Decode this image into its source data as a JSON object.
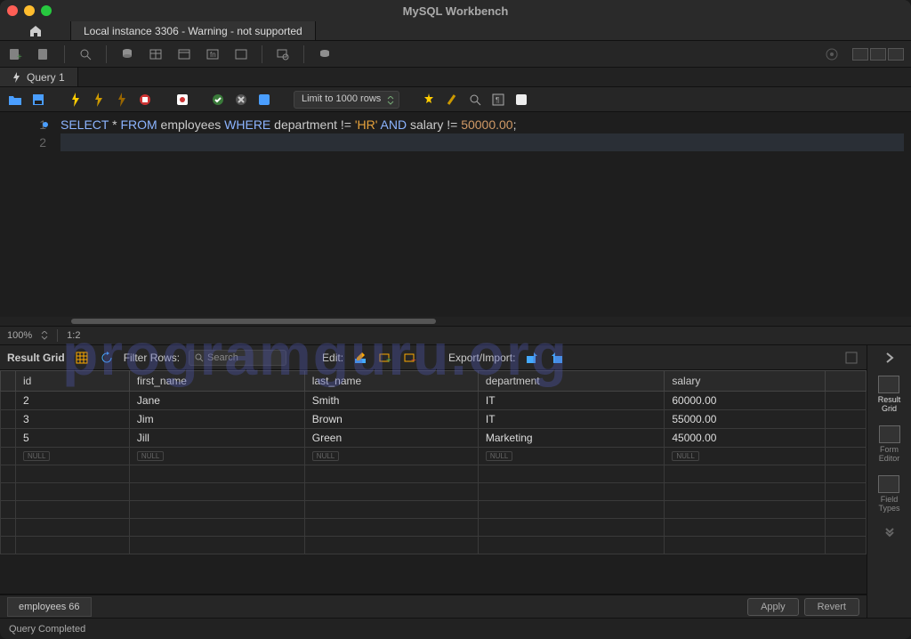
{
  "app_title": "MySQL Workbench",
  "connection_tab": "Local instance 3306 - Warning - not supported",
  "query_tab": "Query 1",
  "limit_label": "Limit to 1000 rows",
  "sql": {
    "line1_tokens": [
      "SELECT",
      " * ",
      "FROM",
      " employees ",
      "WHERE",
      " department != ",
      "'HR'",
      " ",
      "AND",
      " salary != ",
      "50000.00",
      ";"
    ]
  },
  "zoom": {
    "pct": "100%",
    "ratio": "1:2"
  },
  "result_toolbar": {
    "label": "Result Grid",
    "filter_label": "Filter Rows:",
    "search_placeholder": "Search",
    "edit_label": "Edit:",
    "export_label": "Export/Import:"
  },
  "columns": [
    "id",
    "first_name",
    "last_name",
    "department",
    "salary"
  ],
  "rows": [
    {
      "id": "2",
      "first_name": "Jane",
      "last_name": "Smith",
      "department": "IT",
      "salary": "60000.00"
    },
    {
      "id": "3",
      "first_name": "Jim",
      "last_name": "Brown",
      "department": "IT",
      "salary": "55000.00"
    },
    {
      "id": "5",
      "first_name": "Jill",
      "last_name": "Green",
      "department": "Marketing",
      "salary": "45000.00"
    }
  ],
  "null_label": "NULL",
  "side_panel": {
    "result_grid": "Result\nGrid",
    "form_editor": "Form\nEditor",
    "field_types": "Field\nTypes"
  },
  "result_tab": "employees 66",
  "buttons": {
    "apply": "Apply",
    "revert": "Revert"
  },
  "status": "Query Completed",
  "watermark": "programguru.org",
  "chart_data": {
    "type": "table",
    "columns": [
      "id",
      "first_name",
      "last_name",
      "department",
      "salary"
    ],
    "rows": [
      [
        2,
        "Jane",
        "Smith",
        "IT",
        60000.0
      ],
      [
        3,
        "Jim",
        "Brown",
        "IT",
        55000.0
      ],
      [
        5,
        "Jill",
        "Green",
        "Marketing",
        45000.0
      ]
    ]
  }
}
